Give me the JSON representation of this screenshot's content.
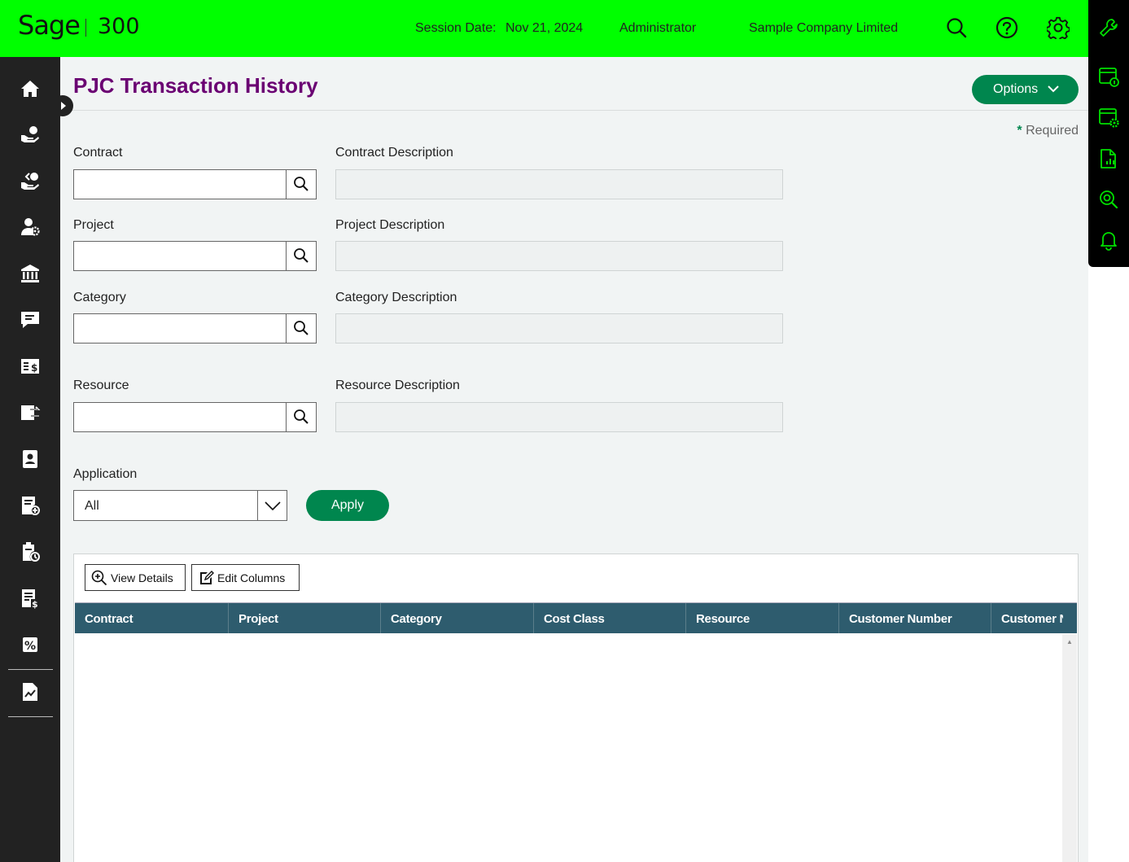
{
  "header": {
    "brand": "Sage",
    "product": "300",
    "session_label": "Session Date:",
    "session_date": "Nov 21, 2024",
    "user": "Administrator",
    "company": "Sample Company Limited"
  },
  "page": {
    "title": "PJC Transaction History",
    "options_label": "Options",
    "required_marker": "*",
    "required_label": "Required"
  },
  "form": {
    "contract_label": "Contract",
    "contract_value": "",
    "contract_desc_label": "Contract Description",
    "contract_desc_value": "",
    "project_label": "Project",
    "project_value": "",
    "project_desc_label": "Project Description",
    "project_desc_value": "",
    "category_label": "Category",
    "category_value": "",
    "category_desc_label": "Category Description",
    "category_desc_value": "",
    "resource_label": "Resource",
    "resource_value": "",
    "resource_desc_label": "Resource Description",
    "resource_desc_value": "",
    "application_label": "Application",
    "application_value": "All",
    "apply_label": "Apply"
  },
  "grid": {
    "view_details_label": "View Details",
    "edit_columns_label": "Edit Columns",
    "columns": [
      "Contract",
      "Project",
      "Category",
      "Cost Class",
      "Resource",
      "Customer Number",
      "Customer N"
    ],
    "rows": []
  },
  "colors": {
    "topbar": "#00ff00",
    "accent": "#00864e",
    "title": "#6a0072",
    "grid_header": "#2e5c6e",
    "nav_bg": "#222222"
  },
  "icons": {
    "topbar": [
      "search-icon",
      "help-icon",
      "settings-icon"
    ],
    "right_rail": [
      "wrench-icon",
      "window-info-icon",
      "window-settings-icon",
      "report-icon",
      "inquiry-icon",
      "bell-icon"
    ],
    "left_nav": [
      "home-icon",
      "general-ledger-icon",
      "accounts-payable-icon",
      "accounts-receivable-icon",
      "bank-icon",
      "messaging-icon",
      "cash-icon",
      "transfer-icon",
      "contacts-icon",
      "order-entry-icon",
      "project-job-costing-icon",
      "invoices-icon",
      "tax-icon",
      "analytics-icon"
    ]
  }
}
